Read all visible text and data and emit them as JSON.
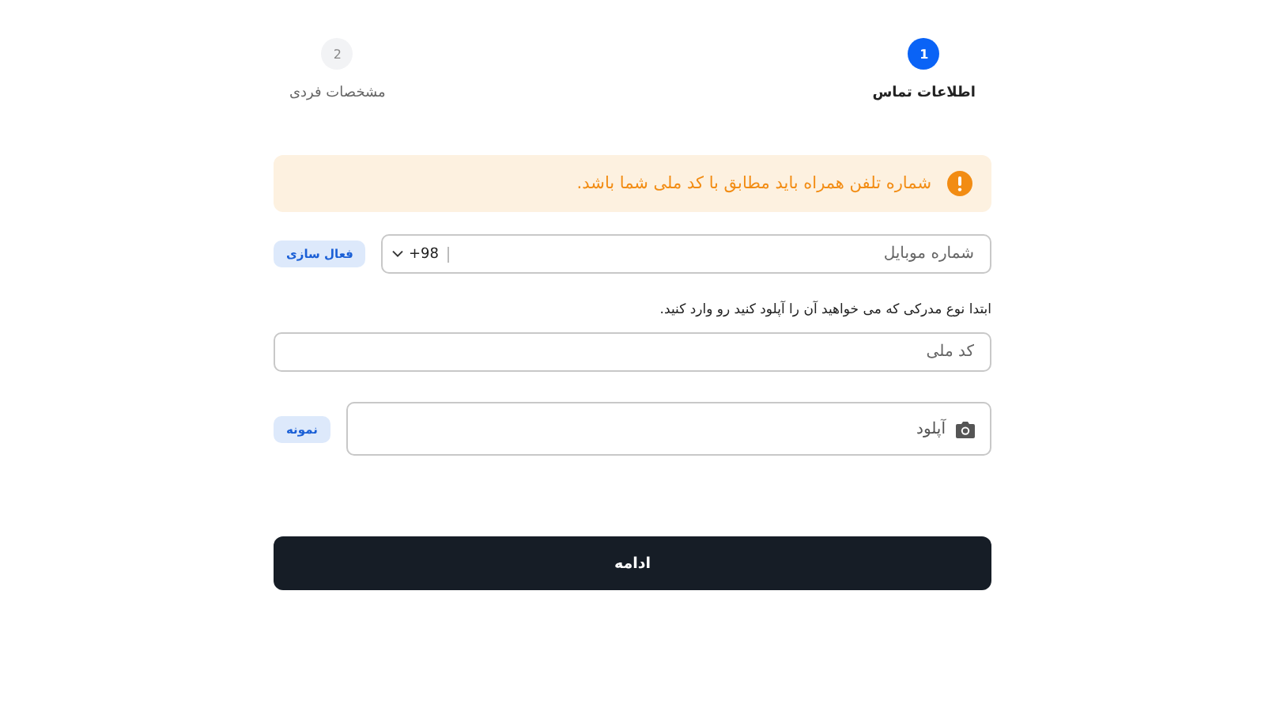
{
  "steps": [
    {
      "number": "1",
      "label": "اطلاعات تماس",
      "selected": true
    },
    {
      "number": "2",
      "label": "مشخصات فردی",
      "selected": false
    }
  ],
  "alert": {
    "text": "شماره تلفن همراه باید مطابق با کد ملی شما باشد."
  },
  "phone": {
    "placeholder": "شماره موبایل",
    "country_code": "+98",
    "button": "فعال سازی"
  },
  "instruction": "ابتدا نوع مدرکی که می خواهید آن را آپلود کنید رو وارد کنید.",
  "national_code": {
    "placeholder": "کد ملی"
  },
  "upload": {
    "label": "آپلود",
    "button": "نمونه"
  },
  "continue_button": "ادامه"
}
